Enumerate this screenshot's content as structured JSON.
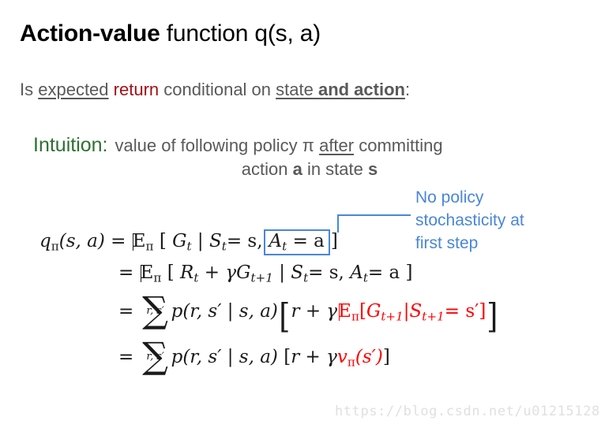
{
  "slide": {
    "background_color": "#FFFFFF",
    "title": {
      "bold_part": "Action-value",
      "rest": " function q(s, a)",
      "color": "#000000"
    },
    "subtitle": {
      "lead": "Is ",
      "expected": "expected",
      "space1": " ",
      "return": "return",
      "middle": " conditional on ",
      "state": "state ",
      "and_action": "and action",
      "colon": ":",
      "text_color": "#595959",
      "return_color": "#A11019"
    },
    "intuition": {
      "label": "Intuition:",
      "label_color": "#2E7031",
      "line1_a": "value of following policy ",
      "line1_pi": "π",
      "line1_after": "after",
      "line1_b": " committing",
      "line2_a": "action ",
      "line2_bold_a": "a",
      "line2_b": " in state ",
      "line2_bold_s": "s",
      "text_color": "#595959"
    },
    "callout": {
      "text": "No policy\nstochasticity at\nfirst step",
      "color": "#4A86D8"
    },
    "equations": {
      "line1": {
        "lhs": "q",
        "lhs_sub": "π",
        "lhs_args": "(s, a)",
        "eq": "=",
        "expectation": "E",
        "exp_sub": "π",
        "open": "[",
        "body": "G",
        "body_sub": "t",
        "bar": "|",
        "cond1": "S",
        "cond1_sub": "t",
        "cond1_eq": "= s,",
        "boxed": "A",
        "boxed_sub": "t",
        "boxed_eq": "= a",
        "close": "]"
      },
      "line2": {
        "eq": "=",
        "expectation": "E",
        "exp_sub": "π",
        "open": "[",
        "term1": "R",
        "term1_sub": "t",
        "plus": "+",
        "gamma": "γ",
        "term2": "G",
        "term2_sub": "t+1",
        "bar": "|",
        "cond1": "S",
        "cond1_sub": "t",
        "cond1_eq": "= s,",
        "cond2": "A",
        "cond2_sub": "t",
        "cond2_eq": "= a",
        "close": "]"
      },
      "line3": {
        "eq": "=",
        "sum_limits": "r, s′",
        "p": "p",
        "p_args": "(r, s′ | s, a)",
        "open": "[",
        "r": "r",
        "plus": "+",
        "gamma": "γ",
        "expectation": "E",
        "exp_sub": "π",
        "red_open": "[",
        "red_body": "G",
        "red_body_sub": "t+1",
        "red_bar": "|",
        "red_cond": "S",
        "red_cond_sub": "t+1",
        "red_cond_eq": "= s′",
        "red_close": "]",
        "close": "]",
        "red_color": "#FF0000"
      },
      "line4": {
        "eq": "=",
        "sum_limits": "r, s′",
        "p": "p",
        "p_args": "(r, s′ | s, a)",
        "open": "[",
        "r": "r",
        "plus": "+",
        "gamma": "γ",
        "v": "v",
        "v_sub": "π",
        "v_args": "(s′)",
        "close": "]",
        "red_color": "#FF0000"
      }
    },
    "watermark": "https://blog.csdn.net/u012151283"
  }
}
